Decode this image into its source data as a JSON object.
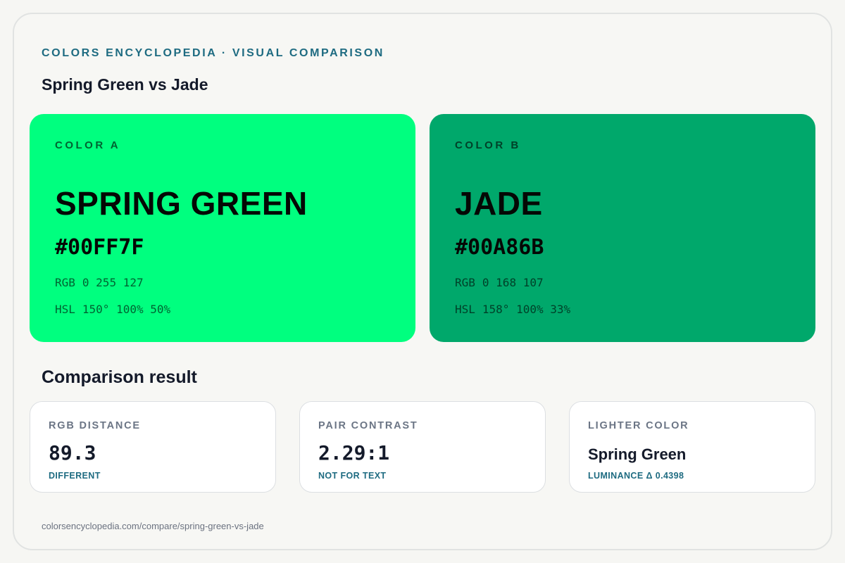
{
  "header": {
    "kicker": "COLORS ENCYCLOPEDIA · VISUAL COMPARISON",
    "title": "Spring Green vs Jade"
  },
  "colors": {
    "a": {
      "slot_label": "COLOR A",
      "name": "SPRING GREEN",
      "hex": "#00FF7F",
      "rgb_key": "RGB",
      "rgb_value": "0 255 127",
      "hsl_key": "HSL",
      "hsl_value": "150° 100% 50%",
      "swatch_color": "#00FF7F"
    },
    "b": {
      "slot_label": "COLOR B",
      "name": "JADE",
      "hex": "#00A86B",
      "rgb_key": "RGB",
      "rgb_value": "0 168 107",
      "hsl_key": "HSL",
      "hsl_value": "158° 100% 33%",
      "swatch_color": "#00A86B"
    }
  },
  "comparison": {
    "heading": "Comparison result",
    "cards": [
      {
        "label": "RGB DISTANCE",
        "value": "89.3",
        "note": "DIFFERENT"
      },
      {
        "label": "PAIR CONTRAST",
        "value": "2.29:1",
        "note": "NOT FOR TEXT"
      },
      {
        "label": "LIGHTER COLOR",
        "value": "Spring Green",
        "note": "LUMINANCE Δ 0.4398"
      }
    ]
  },
  "footer": {
    "url": "colorsencyclopedia.com/compare/spring-green-vs-jade"
  },
  "theme": {
    "accent": "#1E6B81",
    "ink": "#141A2A"
  }
}
